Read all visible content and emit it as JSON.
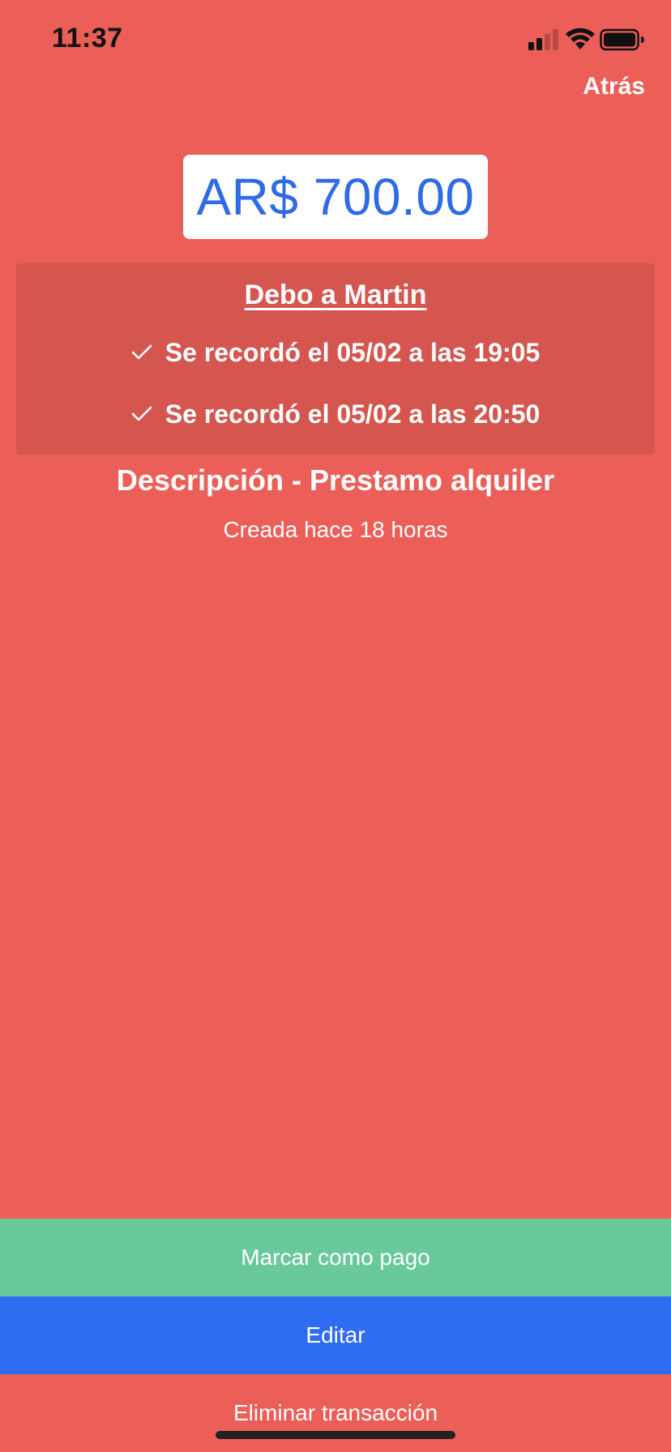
{
  "status_bar": {
    "time": "11:37",
    "signal_icon": "cellular-signal-icon",
    "wifi_icon": "wifi-icon",
    "battery_icon": "battery-icon"
  },
  "nav": {
    "back_label": "Atrás"
  },
  "amount": {
    "value": "AR$ 700.00",
    "color": "#2f6ae8"
  },
  "debt": {
    "title": "Debo a Martin",
    "reminders": [
      {
        "icon": "check-icon",
        "text": "Se recordó el 05/02 a las 19:05"
      },
      {
        "icon": "check-icon",
        "text": "Se recordó el 05/02 a las 20:50"
      }
    ]
  },
  "description": "Descripción - Prestamo alquiler",
  "created": "Creada hace 18 horas",
  "actions": {
    "mark_paid_label": "Marcar como pago",
    "edit_label": "Editar",
    "delete_label": "Eliminar transacción"
  },
  "colors": {
    "background": "#ec5f58",
    "card": "#d4564f",
    "paid_button": "#69c99b",
    "edit_button": "#2e6cf2"
  }
}
